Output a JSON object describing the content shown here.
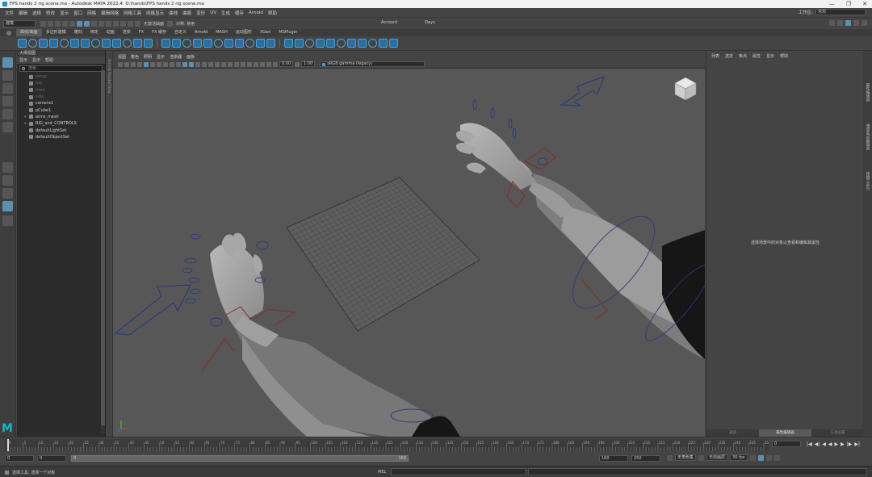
{
  "window": {
    "title": "FPS hands 2 rig scene.ma - Autodesk MAYA 2022.4: D:\\hands\\FPS hands 2 rig scene.ma",
    "controls": [
      "—",
      "❐",
      "✕"
    ]
  },
  "menubar": {
    "items": [
      "文件",
      "编辑",
      "选择",
      "修改",
      "显示",
      "窗口",
      "网格",
      "编辑网格",
      "网格工具",
      "网格显示",
      "曲线",
      "曲面",
      "变形",
      "UV",
      "生成",
      "缓存",
      "Arnold",
      "帮助"
    ],
    "workspace_label": "工作区:",
    "workspace_value": "常规"
  },
  "statusline": {
    "mode": "建模",
    "account": "Account",
    "days": "Days",
    "no_live": "无激活曲面",
    "symmetry": "对称: 禁用"
  },
  "shelf": {
    "tabs": [
      "曲线/曲面",
      "多边形建模",
      "雕刻",
      "绑定",
      "动画",
      "渲染",
      "FX",
      "FX 缓存",
      "自定义",
      "Arnold",
      "MASH",
      "运动图形",
      "XGen",
      "MSPlugin"
    ],
    "active_tab": 0
  },
  "outliner": {
    "title": "大纲视图",
    "menu": [
      "显示",
      "显示",
      "帮助"
    ],
    "search_placeholder": "搜索...",
    "items": [
      {
        "label": "persp",
        "dim": true
      },
      {
        "label": "top",
        "dim": true
      },
      {
        "label": "front",
        "dim": true
      },
      {
        "label": "side",
        "dim": true
      },
      {
        "label": "camera1",
        "dim": false
      },
      {
        "label": "pCube1",
        "dim": false
      },
      {
        "label": "arms_mesh",
        "dim": false,
        "expand": "+"
      },
      {
        "label": "RIG_and_CONTROLS",
        "dim": false,
        "expand": "+"
      },
      {
        "label": "defaultLightSet",
        "dim": false
      },
      {
        "label": "defaultObjectSet",
        "dim": false
      }
    ]
  },
  "sidestrip": {
    "label": "Arnold RenderView"
  },
  "viewport": {
    "menu": [
      "视图",
      "着色",
      "照明",
      "显示",
      "渲染器",
      "面板"
    ],
    "field_a": "0.00",
    "field_b": "1.00",
    "colorspace": "sRGB gamma (legacy)"
  },
  "attribute_editor": {
    "menu": [
      "列表",
      "选定",
      "焦点",
      "属性",
      "显示",
      "帮助"
    ],
    "message": "选择场景中的对象以查看和编辑其属性",
    "tabs": [
      "通道",
      "属性编辑器",
      "工具设置"
    ],
    "active_tab": 1,
    "side_tabs": [
      "属性编辑器",
      "通道盒/层编辑器",
      "建模工具包"
    ]
  },
  "timeslider": {
    "ticks": [
      0,
      5,
      10,
      15,
      20,
      25,
      30,
      35,
      40,
      45,
      50,
      55,
      60,
      65,
      70,
      75,
      80,
      85,
      90,
      95,
      100,
      105,
      110,
      115,
      120,
      125,
      130,
      135,
      140,
      145,
      150,
      155,
      160,
      165,
      170,
      175,
      180,
      185,
      190,
      195,
      200,
      205,
      210,
      215,
      220,
      225,
      230,
      235,
      240,
      245,
      250
    ],
    "current_frame": "0",
    "controls": [
      "|◀",
      "◀|",
      "◀",
      "◀",
      "▶",
      "▶",
      "|▶",
      "▶|"
    ]
  },
  "rangeslider": {
    "start": "0",
    "anim_start": "0",
    "range_start": "0",
    "range_end": "160",
    "anim_end": "160",
    "end": "250",
    "no_char": "无角色集",
    "no_layer": "无动画层",
    "fps": "30 fps"
  },
  "cmdline": {
    "hint": "选择工具: 选择一个对象",
    "mel": "MEL"
  }
}
